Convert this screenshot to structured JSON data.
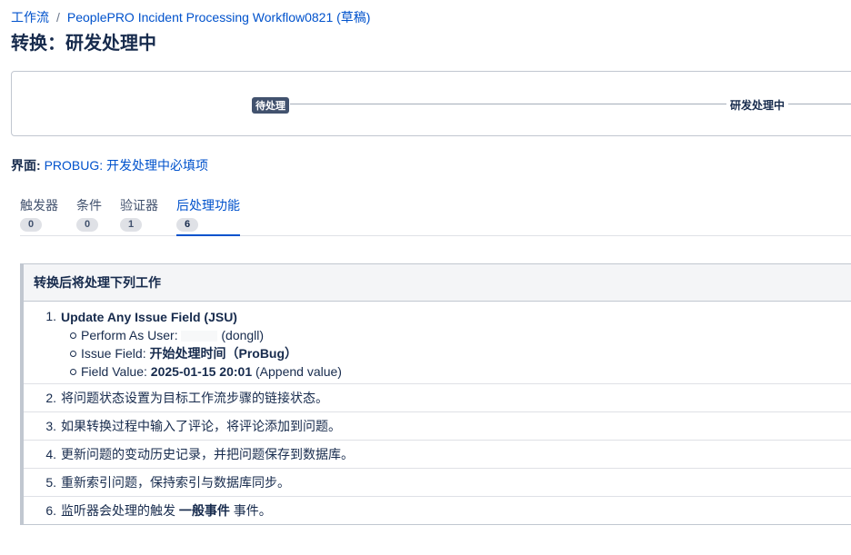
{
  "breadcrumb": {
    "root": "工作流",
    "separator": "/",
    "workflow": "PeoplePRO Incident Processing Workflow0821 (草稿)"
  },
  "page": {
    "title": "转换：研发处理中"
  },
  "diagram": {
    "from_status": "待处理",
    "to_status": "研发处理中"
  },
  "screen": {
    "label": "界面:",
    "link": "PROBUG: 开发处理中必填项"
  },
  "tabs": [
    {
      "label": "触发器",
      "count": "0"
    },
    {
      "label": "条件",
      "count": "0"
    },
    {
      "label": "验证器",
      "count": "1"
    },
    {
      "label": "后处理功能",
      "count": "6",
      "active": true
    }
  ],
  "post_functions": {
    "header": "转换后将处理下列工作",
    "item1": {
      "number": "1.",
      "title": "Update Any Issue Field (JSU)",
      "perform_as_label": "Perform As User:",
      "perform_as_value": "(dongll)",
      "issue_field_label": "Issue Field:",
      "issue_field_value": "开始处理时间（ProBug）",
      "field_value_label": "Field Value:",
      "field_value_value": "2025-01-15 20:01",
      "field_value_suffix": "(Append value)"
    },
    "item2": {
      "number": "2.",
      "text": "将问题状态设置为目标工作流步骤的链接状态。"
    },
    "item3": {
      "number": "3.",
      "text": "如果转换过程中输入了评论，将评论添加到问题。"
    },
    "item4": {
      "number": "4.",
      "text": "更新问题的变动历史记录，并把问题保存到数据库。"
    },
    "item5": {
      "number": "5.",
      "text": "重新索引问题，保持索引与数据库同步。"
    },
    "item6": {
      "number": "6.",
      "text_before": "监听器会处理的触发",
      "event": "一般事件",
      "text_after": "事件。"
    }
  },
  "colors": {
    "link": "#0052cc",
    "text": "#172b4d",
    "status_badge": "#42526e"
  }
}
